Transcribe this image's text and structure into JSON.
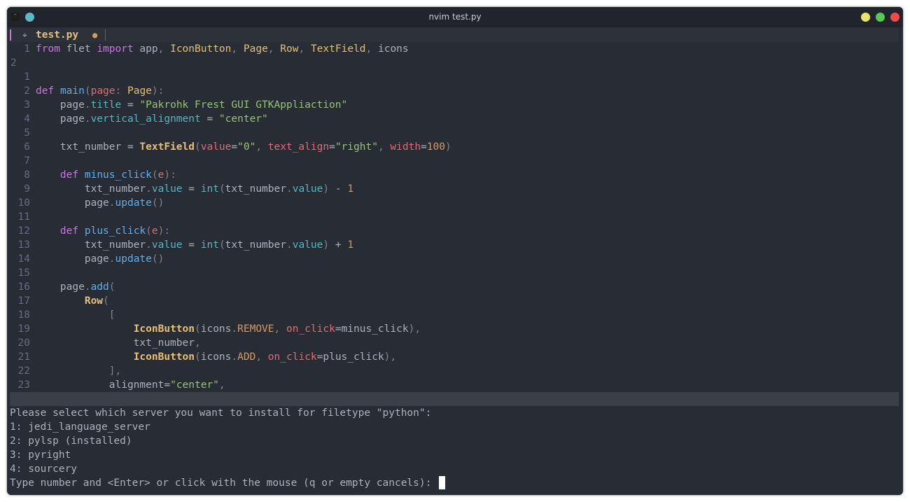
{
  "window": {
    "title": "nvim test.py",
    "icons": {
      "app": "vim-app-icon",
      "pin": "pin-icon"
    },
    "buttons": {
      "minimize_color": "#e8e46a",
      "maximize_color": "#55c855",
      "close_color": "#ee4b4b"
    }
  },
  "tabline": {
    "icon": "python-file-icon",
    "icon_glyph": "⌖",
    "filename": "test.py",
    "modified_glyph": "●"
  },
  "editor": {
    "colors": {
      "background": "#282c34",
      "keyword": "#c678dd",
      "type": "#e5c07b",
      "function": "#61afef",
      "parameter": "#e06c75",
      "string": "#98c379",
      "number": "#d19a66",
      "property": "#56b6c2"
    },
    "lines": [
      {
        "n": "1",
        "wrap": false,
        "tokens": [
          [
            "kw",
            "from"
          ],
          [
            "",
            "flet"
          ],
          [
            "kw",
            "import"
          ],
          [
            "",
            "app,"
          ],
          [
            "ty",
            "IconButton,"
          ],
          [
            "ty",
            "Page,"
          ],
          [
            "ty",
            "Row,"
          ],
          [
            "ty",
            "TextField,"
          ],
          [
            "",
            "icons"
          ]
        ],
        "raw": "from flet import app, IconButton, Page, Row, TextField, icons"
      },
      {
        "n": "2",
        "wrap": true,
        "raw": ""
      },
      {
        "n": "1",
        "wrap": false,
        "raw": ""
      },
      {
        "n": "2",
        "wrap": false,
        "raw": "def main(page: Page):"
      },
      {
        "n": "3",
        "wrap": false,
        "raw": "    page.title = \"Pakrohk Frest GUI GTKAppliaction\""
      },
      {
        "n": "4",
        "wrap": false,
        "raw": "    page.vertical_alignment = \"center\""
      },
      {
        "n": "5",
        "wrap": false,
        "raw": ""
      },
      {
        "n": "6",
        "wrap": false,
        "raw": "    txt_number = TextField(value=\"0\", text_align=\"right\", width=100)"
      },
      {
        "n": "7",
        "wrap": false,
        "raw": ""
      },
      {
        "n": "8",
        "wrap": false,
        "raw": "    def minus_click(e):"
      },
      {
        "n": "9",
        "wrap": false,
        "raw": "        txt_number.value = int(txt_number.value) - 1"
      },
      {
        "n": "10",
        "wrap": false,
        "raw": "        page.update()"
      },
      {
        "n": "11",
        "wrap": false,
        "raw": ""
      },
      {
        "n": "12",
        "wrap": false,
        "raw": "    def plus_click(e):"
      },
      {
        "n": "13",
        "wrap": false,
        "raw": "        txt_number.value = int(txt_number.value) + 1"
      },
      {
        "n": "14",
        "wrap": false,
        "raw": "        page.update()"
      },
      {
        "n": "15",
        "wrap": false,
        "raw": ""
      },
      {
        "n": "16",
        "wrap": false,
        "raw": "    page.add("
      },
      {
        "n": "17",
        "wrap": false,
        "raw": "        Row("
      },
      {
        "n": "18",
        "wrap": false,
        "raw": "            ["
      },
      {
        "n": "19",
        "wrap": false,
        "raw": "                IconButton(icons.REMOVE, on_click=minus_click),"
      },
      {
        "n": "20",
        "wrap": false,
        "raw": "                txt_number,"
      },
      {
        "n": "21",
        "wrap": false,
        "raw": "                IconButton(icons.ADD, on_click=plus_click),"
      },
      {
        "n": "22",
        "wrap": false,
        "raw": "            ],"
      },
      {
        "n": "23",
        "wrap": false,
        "raw": "            alignment=\"center\","
      }
    ]
  },
  "prompt": {
    "question": "Please select which server you want to install for filetype \"python\":",
    "options": [
      "1: jedi_language_server",
      "2: pylsp (installed)",
      "3: pyright",
      "4: sourcery"
    ],
    "input_prompt": "Type number and <Enter> or click with the mouse (q or empty cancels): "
  }
}
